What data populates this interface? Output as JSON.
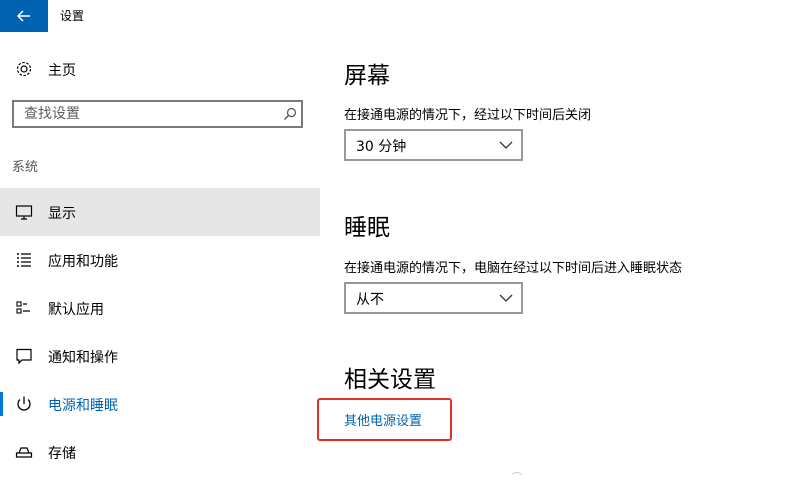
{
  "window": {
    "title": "设置",
    "back_icon": "arrow-left-icon",
    "accent_color": "#0063b1"
  },
  "sidebar": {
    "home_label": "主页",
    "search_placeholder": "查找设置",
    "section_label": "系统",
    "items": [
      {
        "label": "显示",
        "icon": "monitor-icon",
        "selected": true
      },
      {
        "label": "应用和功能",
        "icon": "list-icon"
      },
      {
        "label": "默认应用",
        "icon": "default-apps-icon"
      },
      {
        "label": "通知和操作",
        "icon": "message-icon"
      },
      {
        "label": "电源和睡眠",
        "icon": "power-icon",
        "active": true
      },
      {
        "label": "存储",
        "icon": "storage-icon"
      }
    ]
  },
  "main": {
    "screen": {
      "heading": "屏幕",
      "description": "在接通电源的情况下，经过以下时间后关闭",
      "value": "30 分钟"
    },
    "sleep": {
      "heading": "睡眠",
      "description": "在接通电源的情况下，电脑在经过以下时间后进入睡眠状态",
      "value": "从不"
    },
    "related": {
      "heading": "相关设置",
      "link": "其他电源设置",
      "highlight_color": "#e0302a"
    }
  }
}
